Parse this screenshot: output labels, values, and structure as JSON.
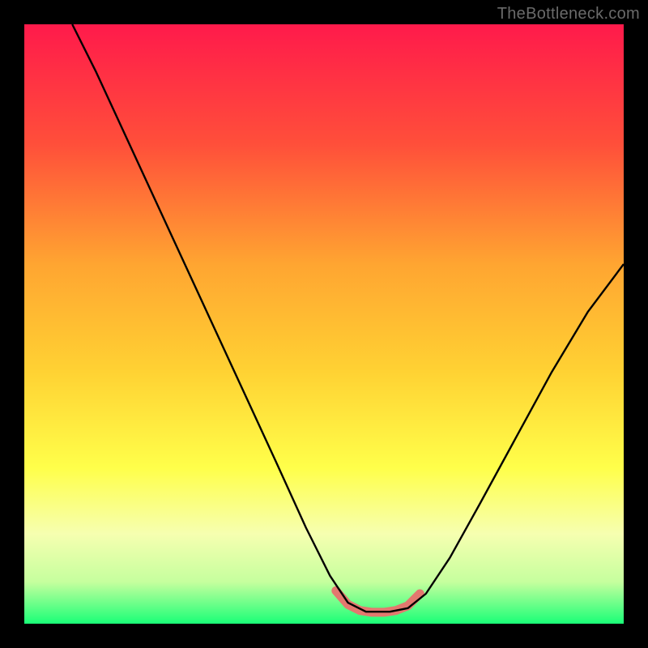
{
  "watermark": "TheBottleneck.com",
  "chart_data": {
    "type": "line",
    "title": "",
    "xlabel": "",
    "ylabel": "",
    "xlim": [
      0,
      100
    ],
    "ylim": [
      0,
      100
    ],
    "gradient_stops": [
      {
        "offset": 0,
        "color": "#ff1a4b"
      },
      {
        "offset": 20,
        "color": "#ff4f3a"
      },
      {
        "offset": 40,
        "color": "#ffa531"
      },
      {
        "offset": 58,
        "color": "#ffd233"
      },
      {
        "offset": 74,
        "color": "#ffff4a"
      },
      {
        "offset": 85,
        "color": "#f6ffb0"
      },
      {
        "offset": 93,
        "color": "#c6ff9e"
      },
      {
        "offset": 100,
        "color": "#1aff77"
      }
    ],
    "series": [
      {
        "name": "bottleneck-curve",
        "stroke": "#000000",
        "stroke_width": 2.4,
        "points": [
          {
            "x": 8,
            "y": 100
          },
          {
            "x": 12,
            "y": 92
          },
          {
            "x": 18,
            "y": 79
          },
          {
            "x": 24,
            "y": 66
          },
          {
            "x": 30,
            "y": 53
          },
          {
            "x": 36,
            "y": 40
          },
          {
            "x": 42,
            "y": 27
          },
          {
            "x": 47,
            "y": 16
          },
          {
            "x": 51,
            "y": 8
          },
          {
            "x": 54,
            "y": 3.5
          },
          {
            "x": 57,
            "y": 2
          },
          {
            "x": 61,
            "y": 2
          },
          {
            "x": 64,
            "y": 2.6
          },
          {
            "x": 67,
            "y": 5
          },
          {
            "x": 71,
            "y": 11
          },
          {
            "x": 76,
            "y": 20
          },
          {
            "x": 82,
            "y": 31
          },
          {
            "x": 88,
            "y": 42
          },
          {
            "x": 94,
            "y": 52
          },
          {
            "x": 100,
            "y": 60
          }
        ]
      },
      {
        "name": "optimal-zone-highlight",
        "stroke": "#e3786f",
        "stroke_width": 11,
        "linecap": "round",
        "points": [
          {
            "x": 52,
            "y": 5.5
          },
          {
            "x": 54,
            "y": 3.2
          },
          {
            "x": 56,
            "y": 2.2
          },
          {
            "x": 58,
            "y": 1.9
          },
          {
            "x": 60,
            "y": 1.9
          },
          {
            "x": 62,
            "y": 2.2
          },
          {
            "x": 64,
            "y": 3.0
          },
          {
            "x": 66,
            "y": 5.0
          }
        ]
      }
    ]
  }
}
